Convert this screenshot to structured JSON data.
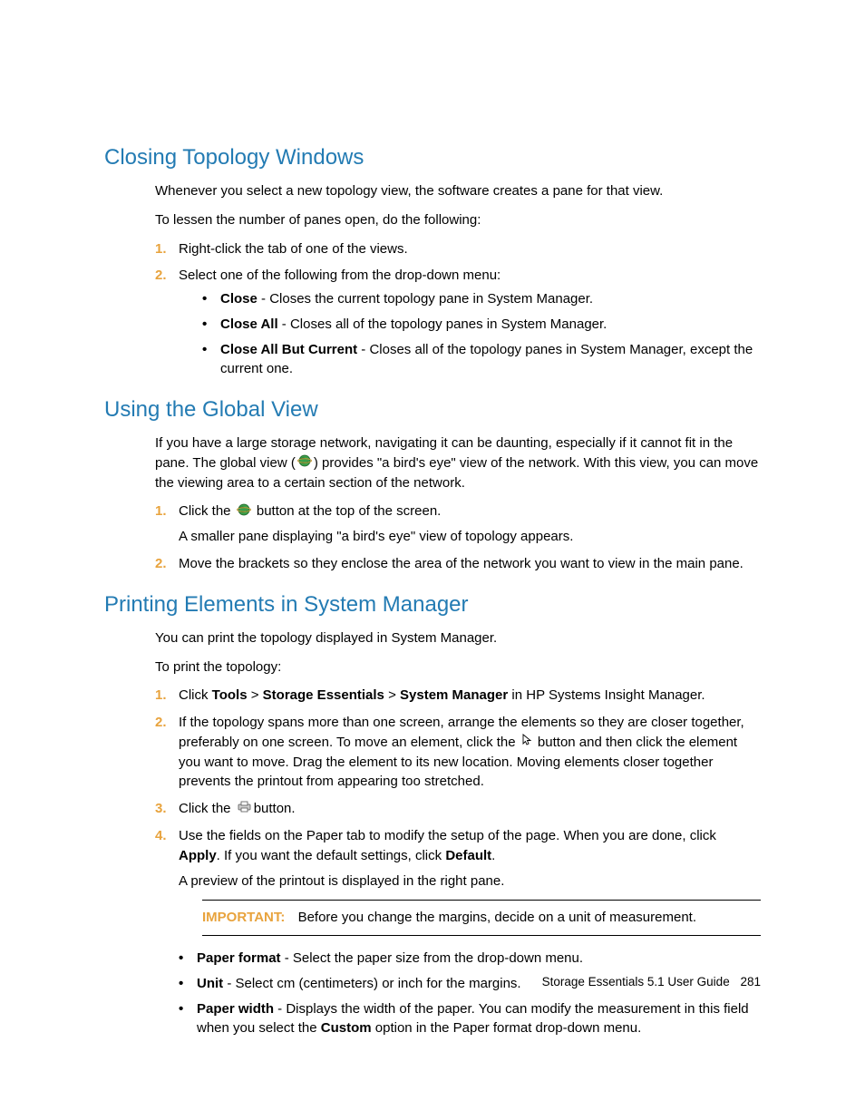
{
  "headings": {
    "h_close": "Closing Topology Windows",
    "h_global": "Using the Global View",
    "h_print": "Printing Elements in System Manager"
  },
  "close": {
    "p1": "Whenever you select a new topology view, the software creates a pane for that view.",
    "p2": "To lessen the number of panes open, do the following:",
    "step1": "Right-click the tab of one of the views.",
    "step2": "Select one of the following from the drop-down menu:",
    "close_b": "Close",
    "close_t": " - Closes the current topology pane in System Manager.",
    "closeall_b": "Close All",
    "closeall_t": " - Closes all of the topology panes in System Manager.",
    "closebut_b": "Close All But Current",
    "closebut_t": " - Closes all of the topology panes in System Manager, except the current one."
  },
  "global": {
    "p1a": "If you have a large storage network, navigating it can be daunting, especially if it cannot fit in the pane. The global view (",
    "p1b": ") provides \"a bird's eye\" view of the network. With this view, you can move the viewing area to a certain section of the network.",
    "step1a": "Click the ",
    "step1b": " button at the top of the screen.",
    "step1_sub": "A smaller pane displaying \"a bird's eye\" view of topology appears.",
    "step2": "Move the brackets so they enclose the area of the network you want to view in the main pane."
  },
  "print": {
    "p1": "You can print the topology displayed in System Manager.",
    "p2": "To print the topology:",
    "step1_a": "Click ",
    "tools": "Tools",
    "gt1": " > ",
    "se": "Storage Essentials",
    "gt2": " > ",
    "sm": "System Manager",
    "step1_b": " in HP Systems Insight Manager.",
    "step2_a": "If the topology spans more than one screen, arrange the elements so they are closer together, preferably on one screen. To move an element, click the ",
    "step2_b": " button and then click the element you want to move. Drag the element to its new location. Moving elements closer together prevents the printout from appearing too stretched.",
    "step3_a": "Click the ",
    "step3_b": "button.",
    "step4_a": "Use the fields on the Paper tab to modify the setup of the page. When you are done, click ",
    "apply": "Apply",
    "step4_b": ". If you want the default settings, click ",
    "default": "Default",
    "step4_c": ".",
    "step4_sub": "A preview of the printout is displayed in the right pane.",
    "important_label": "IMPORTANT:",
    "important_text": "Before you change the margins, decide on a unit of measurement.",
    "pf_b": "Paper format",
    "pf_t": " - Select the paper size from the drop-down menu.",
    "unit_b": "Unit",
    "unit_t": " - Select cm (centimeters) or inch for the margins.",
    "pw_b": "Paper width",
    "pw_t1": " - Displays the width of the paper. You can modify the measurement in this field when you select the ",
    "custom": "Custom",
    "pw_t2": " option in the Paper format drop-down menu."
  },
  "footer": {
    "text": "Storage Essentials 5.1 User Guide",
    "page": "281"
  }
}
